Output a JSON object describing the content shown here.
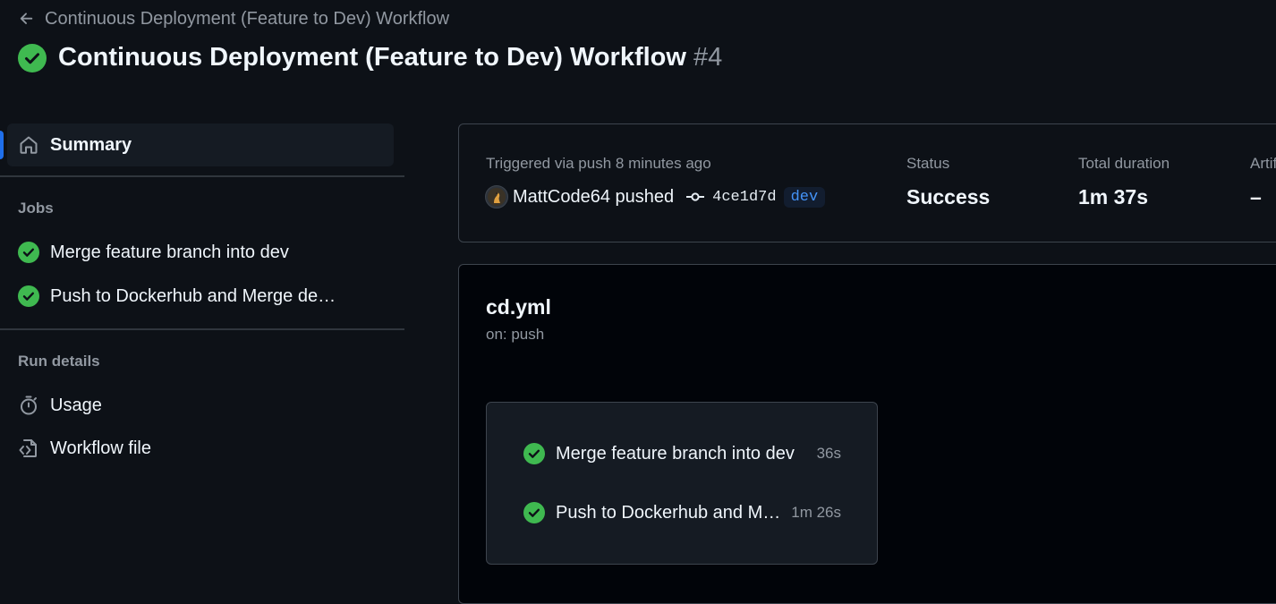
{
  "header": {
    "back_label": "Continuous Deployment (Feature to Dev) Workflow",
    "title": "Continuous Deployment (Feature to Dev) Workflow",
    "run_number": "#4"
  },
  "sidebar": {
    "summary_label": "Summary",
    "jobs_heading": "Jobs",
    "jobs": [
      {
        "label": "Merge feature branch into dev",
        "status": "success"
      },
      {
        "label": "Push to Dockerhub and Merge dev into main",
        "status": "success"
      }
    ],
    "run_details_heading": "Run details",
    "run_details": [
      {
        "label": "Usage",
        "icon": "stopwatch-icon"
      },
      {
        "label": "Workflow file",
        "icon": "file-code-icon"
      }
    ]
  },
  "summary": {
    "trigger_text": "Triggered via push 8 minutes ago",
    "actor": "MattCode64",
    "action": "pushed",
    "actor_text": "MattCode64 pushed",
    "commit_sha": "4ce1d7d",
    "branch": "dev",
    "status_label": "Status",
    "status_value": "Success",
    "duration_label": "Total duration",
    "duration_value": "1m 37s",
    "artifacts_label": "Artifacts",
    "artifacts_value": "–"
  },
  "graph": {
    "file_name": "cd.yml",
    "trigger": "on: push",
    "jobs": [
      {
        "label": "Merge feature branch into dev",
        "duration": "36s",
        "status": "success"
      },
      {
        "label": "Push to Dockerhub and Merge dev into main",
        "duration": "1m 26s",
        "status": "success"
      }
    ]
  },
  "colors": {
    "background": "#0d1117",
    "success": "#3fb950",
    "accent": "#1f6feb",
    "link": "#4493f8",
    "muted_text": "#9198a1",
    "border": "#3d444d"
  }
}
